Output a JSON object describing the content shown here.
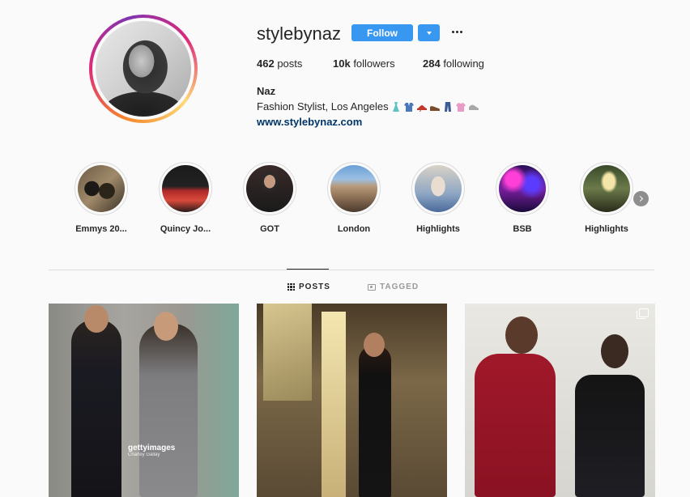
{
  "profile": {
    "username": "stylebynaz",
    "follow_label": "Follow",
    "stats": {
      "posts_count": "462",
      "posts_label": " posts",
      "followers_count": "10k",
      "followers_label": " followers",
      "following_count": "284",
      "following_label": " following"
    },
    "full_name": "Naz",
    "bio": "Fashion Stylist, Los Angeles",
    "bio_emojis": [
      "dress",
      "kimono",
      "high-heel",
      "mans-shoe",
      "jeans",
      "tshirt",
      "sneaker"
    ],
    "website": "www.stylebynaz.com"
  },
  "highlights": [
    {
      "label": "Emmys 20..."
    },
    {
      "label": "Quincy Jo..."
    },
    {
      "label": "GOT"
    },
    {
      "label": "London"
    },
    {
      "label": "Highlights"
    },
    {
      "label": "BSB"
    },
    {
      "label": "Highlights"
    }
  ],
  "tabs": {
    "posts": "POSTS",
    "tagged": "TAGGED"
  },
  "posts": {
    "watermark": "gettyimages",
    "watermark_credit": "Charley Gallay"
  },
  "colors": {
    "accent": "#3897f0",
    "link": "#003569",
    "text": "#262626",
    "muted": "#999999",
    "background": "#fafafa"
  }
}
